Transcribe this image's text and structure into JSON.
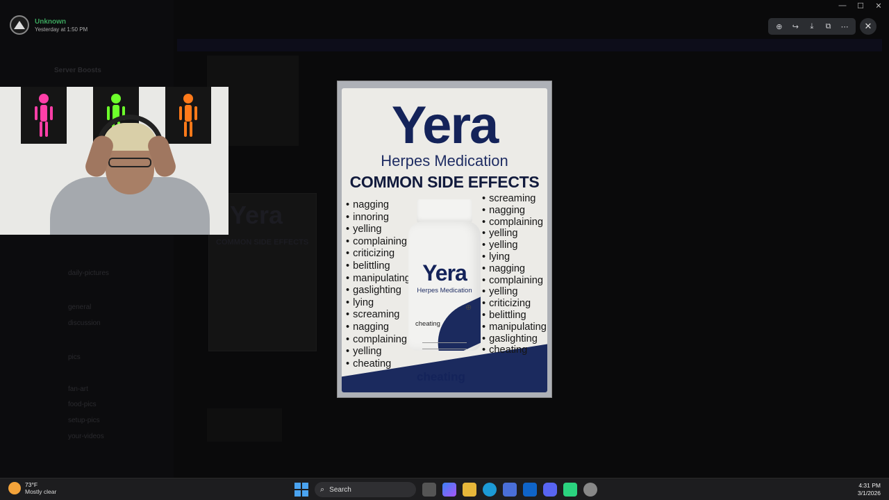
{
  "app": {
    "user_name": "Unknown",
    "user_time": "Yesterday at 1:50 PM"
  },
  "background": {
    "server_name": "Server Boosts",
    "channels": [
      "daily-pictures",
      "general",
      "discussion",
      "pics",
      "fan-art",
      "food-pics",
      "setup-pics",
      "your-videos"
    ]
  },
  "viewer": {
    "toolbar": [
      {
        "name": "zoom-icon",
        "glyph": "⊕"
      },
      {
        "name": "forward-icon",
        "glyph": "↪"
      },
      {
        "name": "download-icon",
        "glyph": "⤓"
      },
      {
        "name": "open-external-icon",
        "glyph": "⧉"
      },
      {
        "name": "more-icon",
        "glyph": "⋯"
      }
    ],
    "close_glyph": "✕"
  },
  "window": {
    "minimize": "—",
    "maximize": "☐",
    "close": "✕"
  },
  "image": {
    "brand": "Yera",
    "subtitle": "Herpes Medication",
    "side_effects_title": "COMMON SIDE EFFECTS",
    "left_effects": [
      "nagging",
      "innoring",
      "yelling",
      "complaining",
      "criticizing",
      "belittling",
      "manipulating",
      "gaslighting",
      "lying",
      "screaming",
      "nagging",
      "complaining",
      "yelling",
      "cheating"
    ],
    "right_effects": [
      "screaming",
      "nagging",
      "complaining",
      "yelling",
      "yelling",
      "lying",
      "nagging",
      "complaining",
      "yelling",
      "criticizing",
      "belittling",
      "manipulating",
      "gaslighting",
      "cheating"
    ],
    "bottle_brand": "Yera",
    "bottle_subtitle": "Herpes Medication",
    "bottle_label": "cheating",
    "box_bottom": "cheating"
  },
  "taskbar": {
    "temperature": "73°F",
    "weather": "Mostly clear",
    "search_label": "Search",
    "time": "4:31 PM",
    "date": "3/1/2026"
  },
  "colors": {
    "brand_navy": "#14235a",
    "background": "#050505",
    "taskbar": "#1d1d1f"
  }
}
